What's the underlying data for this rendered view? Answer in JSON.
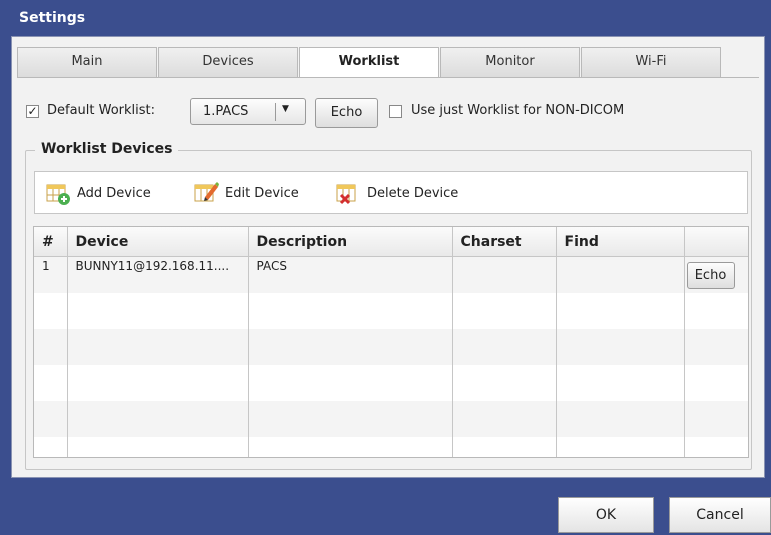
{
  "window": {
    "title": "Settings"
  },
  "tabs": [
    {
      "label": "Main"
    },
    {
      "label": "Devices"
    },
    {
      "label": "Worklist"
    },
    {
      "label": "Monitor"
    },
    {
      "label": "Wi-Fi"
    }
  ],
  "active_tab": "Worklist",
  "worklist": {
    "default_label": "Default Worklist:",
    "default_checked": true,
    "default_value": "1.PACS",
    "echo_label": "Echo",
    "non_dicom_label": "Use just Worklist for NON-DICOM",
    "non_dicom_checked": false
  },
  "devices_group": {
    "legend": "Worklist Devices",
    "toolbar": {
      "add": "Add Device",
      "edit": "Edit Device",
      "delete": "Delete Device"
    }
  },
  "table": {
    "columns": [
      "#",
      "Device",
      "Description",
      "Charset",
      "Find",
      ""
    ],
    "rows": [
      {
        "num": "1",
        "device": "BUNNY11@192.168.11....",
        "description": "PACS",
        "charset": "",
        "find": "",
        "action": "Echo"
      }
    ]
  },
  "footer": {
    "ok": "OK",
    "cancel": "Cancel"
  },
  "colors": {
    "titlebar": "#3b4e8e",
    "panel": "#f2f2f2"
  },
  "icons": [
    "checkmark-icon",
    "dropdown-arrow-icon",
    "add-device-icon",
    "edit-device-icon",
    "delete-device-icon"
  ]
}
